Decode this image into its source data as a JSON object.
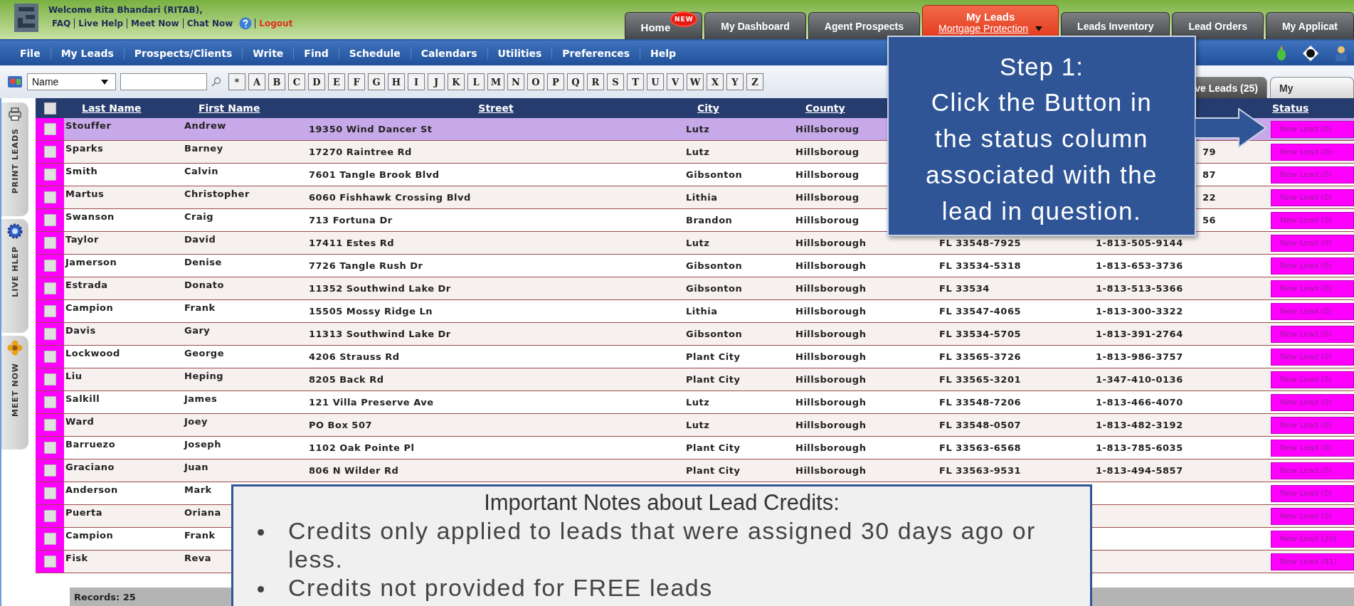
{
  "header": {
    "welcome": "Welcome Rita Bhandari (RITAB),",
    "links": [
      "FAQ",
      "Live Help",
      "Meet Now",
      "Chat Now"
    ],
    "logout": "Logout"
  },
  "nav_tabs": [
    {
      "label": "Home",
      "badge": "NEW",
      "selected": false
    },
    {
      "label": "My Dashboard",
      "selected": false
    },
    {
      "label": "Agent Prospects",
      "selected": false
    },
    {
      "label": "My Leads",
      "sublabel": "Mortgage Protection",
      "selected": true
    },
    {
      "label": "Leads Inventory",
      "selected": false
    },
    {
      "label": "Lead Orders",
      "selected": false
    },
    {
      "label": "My Applicat",
      "selected": false
    }
  ],
  "menu": [
    "File",
    "My Leads",
    "Prospects/Clients",
    "Write",
    "Find",
    "Schedule",
    "Calendars",
    "Utilities",
    "Preferences",
    "Help"
  ],
  "search": {
    "field": "Name",
    "letters": [
      "*",
      "A",
      "B",
      "C",
      "D",
      "E",
      "F",
      "G",
      "H",
      "I",
      "J",
      "K",
      "L",
      "M",
      "N",
      "O",
      "P",
      "Q",
      "R",
      "S",
      "T",
      "U",
      "V",
      "W",
      "X",
      "Y",
      "Z"
    ]
  },
  "list_tabs": [
    {
      "label": "ve Leads (25)",
      "selected": true
    },
    {
      "label": "My",
      "selected": false
    }
  ],
  "sidebar": [
    {
      "label": "PRINT LEADS"
    },
    {
      "label": "LIVE HLEP"
    },
    {
      "label": "MEET NOW"
    }
  ],
  "table": {
    "all_checked": false,
    "columns": [
      "Last Name",
      "First Name",
      "Street",
      "City",
      "County",
      "Status"
    ],
    "rows": [
      {
        "last": "Stouffer",
        "first": "Andrew",
        "street": "19350 Wind Dancer St",
        "city": "Lutz",
        "county": "Hillsboroug",
        "status": "New Lead (0)",
        "checked": false,
        "selected": true
      },
      {
        "last": "Sparks",
        "first": "Barney",
        "street": "17270 Raintree Rd",
        "city": "Lutz",
        "county": "Hillsboroug",
        "phone": "79",
        "status": "New Lead (0)",
        "checked": false,
        "selected": false
      },
      {
        "last": "Smith",
        "first": "Calvin",
        "street": "7601 Tangle Brook Blvd",
        "city": "Gibsonton",
        "county": "Hillsboroug",
        "phone": "87",
        "status": "New Lead (0)",
        "checked": false,
        "selected": false
      },
      {
        "last": "Martus",
        "first": "Christopher",
        "street": "6060 Fishhawk Crossing Blvd",
        "city": "Lithia",
        "county": "Hillsboroug",
        "phone": "22",
        "status": "New Lead (0)",
        "checked": false,
        "selected": false
      },
      {
        "last": "Swanson",
        "first": "Craig",
        "street": "713 Fortuna Dr",
        "city": "Brandon",
        "county": "Hillsboroug",
        "phone": "56",
        "status": "New Lead (0)",
        "checked": false,
        "selected": false
      },
      {
        "last": "Taylor",
        "first": "David",
        "street": "17411 Estes Rd",
        "city": "Lutz",
        "county": "Hillsborough",
        "zip": "FL 33548-7925",
        "phone": "1-813-505-9144",
        "status": "New Lead (0)",
        "checked": false,
        "selected": false
      },
      {
        "last": "Jamerson",
        "first": "Denise",
        "street": "7726 Tangle Rush Dr",
        "city": "Gibsonton",
        "county": "Hillsborough",
        "zip": "FL 33534-5318",
        "phone": "1-813-653-3736",
        "status": "New Lead (0)",
        "checked": false,
        "selected": false
      },
      {
        "last": "Estrada",
        "first": "Donato",
        "street": "11352 Southwind Lake Dr",
        "city": "Gibsonton",
        "county": "Hillsborough",
        "zip": "FL 33534",
        "phone": "1-813-513-5366",
        "status": "New Lead (0)",
        "checked": false,
        "selected": false
      },
      {
        "last": "Campion",
        "first": "Frank",
        "street": "15505 Mossy Ridge Ln",
        "city": "Lithia",
        "county": "Hillsborough",
        "zip": "FL 33547-4065",
        "phone": "1-813-300-3322",
        "status": "New Lead (0)",
        "checked": false,
        "selected": false
      },
      {
        "last": "Davis",
        "first": "Gary",
        "street": "11313 Southwind Lake Dr",
        "city": "Gibsonton",
        "county": "Hillsborough",
        "zip": "FL 33534-5705",
        "phone": "1-813-391-2764",
        "status": "New Lead (0)",
        "checked": false,
        "selected": false
      },
      {
        "last": "Lockwood",
        "first": "George",
        "street": "4206 Strauss Rd",
        "city": "Plant City",
        "county": "Hillsborough",
        "zip": "FL 33565-3726",
        "phone": "1-813-986-3757",
        "status": "New Lead (0)",
        "checked": false,
        "selected": false
      },
      {
        "last": "Liu",
        "first": "Heping",
        "street": "8205 Back Rd",
        "city": "Plant City",
        "county": "Hillsborough",
        "zip": "FL 33565-3201",
        "phone": "1-347-410-0136",
        "status": "New Lead (0)",
        "checked": false,
        "selected": false
      },
      {
        "last": "Salkill",
        "first": "James",
        "street": "121 Villa Preserve Ave",
        "city": "Lutz",
        "county": "Hillsborough",
        "zip": "FL 33548-7206",
        "phone": "1-813-466-4070",
        "status": "New Lead (0)",
        "checked": false,
        "selected": false
      },
      {
        "last": "Ward",
        "first": "Joey",
        "street": "PO Box 507",
        "city": "Lutz",
        "county": "Hillsborough",
        "zip": "FL 33548-0507",
        "phone": "1-813-482-3192",
        "status": "New Lead (0)",
        "checked": false,
        "selected": false
      },
      {
        "last": "Barruezo",
        "first": "Joseph",
        "street": "1102 Oak Pointe Pl",
        "city": "Plant City",
        "county": "Hillsborough",
        "zip": "FL 33563-6568",
        "phone": "1-813-785-6035",
        "status": "New Lead (0)",
        "checked": false,
        "selected": false
      },
      {
        "last": "Graciano",
        "first": "Juan",
        "street": "806 N Wilder Rd",
        "city": "Plant City",
        "county": "Hillsborough",
        "zip": "FL 33563-9531",
        "phone": "1-813-494-5857",
        "status": "New Lead (0)",
        "checked": false,
        "selected": false
      },
      {
        "last": "Anderson",
        "first": "Mark",
        "status": "New Lead (0)",
        "checked": false,
        "selected": false
      },
      {
        "last": "Puerta",
        "first": "Oriana",
        "status": "New Lead (0)",
        "checked": false,
        "selected": false
      },
      {
        "last": "Campion",
        "first": "Frank",
        "status": "New Lead (20)",
        "checked": false,
        "selected": false
      },
      {
        "last": "Fisk",
        "first": "Reva",
        "status": "New Lead (41)",
        "checked": false,
        "selected": false
      }
    ]
  },
  "records": "Records: 25",
  "callout": {
    "title": "Step 1:",
    "text": "Click the Button in the status column associated with the lead in question."
  },
  "notes": {
    "title": "Important Notes about Lead Credits:",
    "bullets": [
      "Credits only applied to leads that were assigned 30 days ago or less.",
      "Credits not provided for FREE leads"
    ]
  }
}
